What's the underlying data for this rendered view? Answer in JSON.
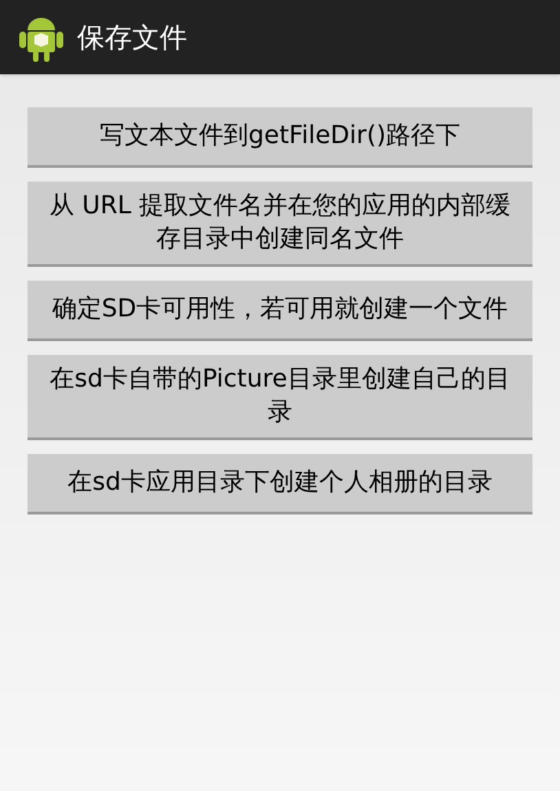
{
  "action_bar": {
    "title": "保存文件"
  },
  "buttons": [
    {
      "label": "写文本文件到getFileDir()路径下"
    },
    {
      "label": "从 URL 提取文件名并在您的应用的内部缓存目录中创建同名文件"
    },
    {
      "label": "确定SD卡可用性，若可用就创建一个文件"
    },
    {
      "label": "在sd卡自带的Picture目录里创建自己的目录"
    },
    {
      "label": "在sd卡应用目录下创建个人相册的目录"
    }
  ]
}
